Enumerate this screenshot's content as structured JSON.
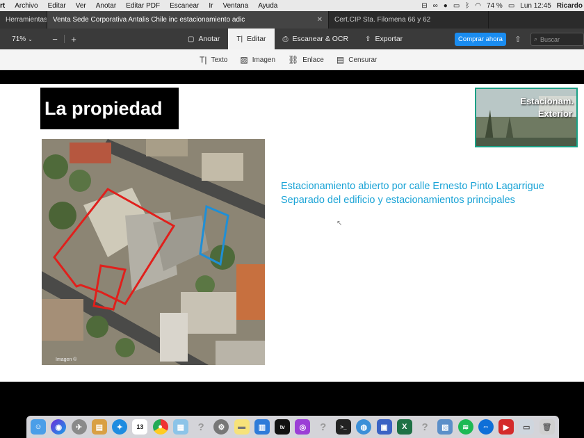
{
  "menubar": {
    "items": [
      "rt",
      "Archivo",
      "Editar",
      "Ver",
      "Anotar",
      "Editar PDF",
      "Escanear",
      "Ir",
      "Ventana",
      "Ayuda"
    ],
    "battery": "74 %",
    "clock": "Lun 12:45",
    "user": "Ricardo"
  },
  "tabs": {
    "sidebar_label": "Herramientas",
    "active": "Venta Sede Corporativa Antalis Chile inc estacionamiento adic",
    "other": "Cert.CIP Sta. Filomena 66 y 62"
  },
  "toolbar": {
    "zoom": "71%",
    "modes": [
      {
        "label": "Anotar",
        "icon": "annotate-icon"
      },
      {
        "label": "Editar",
        "icon": "text-cursor-icon"
      },
      {
        "label": "Escanear & OCR",
        "icon": "scan-icon"
      },
      {
        "label": "Exportar",
        "icon": "export-icon"
      }
    ],
    "buy_label": "Comprar ahora",
    "search_placeholder": "Buscar"
  },
  "edit_tools": [
    {
      "label": "Texto",
      "icon": "text-icon"
    },
    {
      "label": "Imagen",
      "icon": "image-icon"
    },
    {
      "label": "Enlace",
      "icon": "link-icon"
    },
    {
      "label": "Censurar",
      "icon": "redact-icon"
    }
  ],
  "slide": {
    "title": "La propiedad",
    "thumb_line1": "Estacionam.",
    "thumb_line2": "Exterior",
    "caption_line1": "Estacionamiento abierto por calle Ernesto Pinto Lagarrigue",
    "caption_line2": "Separado del edificio y estacionamientos principales",
    "map_credit": "Imagen ©",
    "colors": {
      "outline_red": "#e0201c",
      "outline_blue": "#1f8fd6",
      "caption": "#1aa3d6",
      "thumb_border": "#1aa085"
    }
  },
  "dock": [
    "finder",
    "siri",
    "launchpad",
    "notes",
    "safari",
    "calendar",
    "chrome",
    "preview",
    "unknown",
    "system-preferences",
    "stickies",
    "keynote",
    "apple-tv",
    "podcasts",
    "unknown",
    "terminal",
    "network",
    "screen-sharing",
    "excel",
    "unknown",
    "preview-doc",
    "spotify",
    "teamviewer",
    "presentation",
    "finder-window",
    "trash"
  ],
  "calendar_day": "13"
}
